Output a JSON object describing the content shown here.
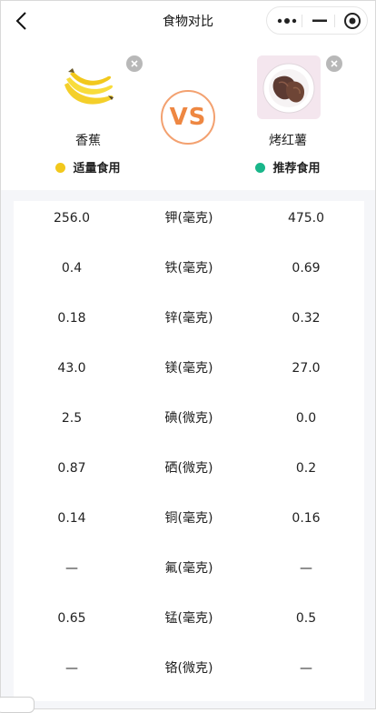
{
  "nav": {
    "title": "食物对比",
    "back_icon": "chevron-left-icon",
    "more_icon": "more-dots-icon",
    "minimize_icon": "minus-icon",
    "close_icon": "target-circle-icon"
  },
  "foods": {
    "left": {
      "name": "香蕉",
      "recommendation": "适量食用",
      "dot_color": "#f2c81c",
      "image_icon": "banana-icon"
    },
    "right": {
      "name": "烤红薯",
      "recommendation": "推荐食用",
      "dot_color": "#19b68a",
      "image_icon": "roasted-sweet-potato-icon"
    },
    "vs_label": "VS",
    "vs_color": "#ee8742"
  },
  "rows": [
    {
      "left": "256.0",
      "label": "钾(毫克)",
      "right": "475.0"
    },
    {
      "left": "0.4",
      "label": "铁(毫克)",
      "right": "0.69"
    },
    {
      "left": "0.18",
      "label": "锌(毫克)",
      "right": "0.32"
    },
    {
      "left": "43.0",
      "label": "镁(毫克)",
      "right": "27.0"
    },
    {
      "left": "2.5",
      "label": "碘(微克)",
      "right": "0.0"
    },
    {
      "left": "0.87",
      "label": "硒(微克)",
      "right": "0.2"
    },
    {
      "left": "0.14",
      "label": "铜(毫克)",
      "right": "0.16"
    },
    {
      "left": "—",
      "label": "氟(毫克)",
      "right": "—"
    },
    {
      "left": "0.65",
      "label": "锰(毫克)",
      "right": "0.5"
    },
    {
      "left": "—",
      "label": "铬(微克)",
      "right": "—"
    }
  ]
}
